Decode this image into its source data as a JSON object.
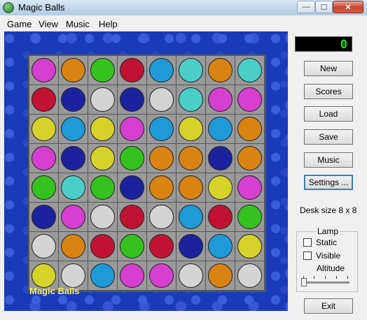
{
  "window": {
    "title": "Magic Balls",
    "minimize": "—",
    "maximize": "☐",
    "close": "✕"
  },
  "menu": [
    "Game",
    "View",
    "Music",
    "Help"
  ],
  "score": "0",
  "buttons": {
    "new": "New",
    "scores": "Scores",
    "load": "Load",
    "save": "Save",
    "music": "Music",
    "settings": "Settings ...",
    "exit": "Exit"
  },
  "desk_size": "Desk size 8 x 8",
  "lamp": {
    "legend": "Lamp",
    "static": "Static",
    "visible": "Visible",
    "altitude": "Altitude"
  },
  "board_label": "Magic Balls",
  "colors": {
    "M": "#d63fcf",
    "O": "#d98313",
    "G": "#35c21f",
    "R": "#c21233",
    "B": "#1e9ad8",
    "T": "#4ccec8",
    "N": "#1c229e",
    "W": "#d4d4d4",
    "Y": "#d6d22a"
  },
  "board": [
    [
      "M",
      "O",
      "G",
      "R",
      "B",
      "T",
      "O",
      "T"
    ],
    [
      "R",
      "N",
      "W",
      "N",
      "W",
      "T",
      "M",
      "M"
    ],
    [
      "Y",
      "B",
      "Y",
      "M",
      "B",
      "Y",
      "B",
      "O"
    ],
    [
      "M",
      "N",
      "Y",
      "G",
      "O",
      "O",
      "N",
      "O"
    ],
    [
      "G",
      "T",
      "G",
      "N",
      "O",
      "O",
      "Y",
      "M"
    ],
    [
      "N",
      "M",
      "W",
      "R",
      "W",
      "B",
      "R",
      "G"
    ],
    [
      "W",
      "O",
      "R",
      "G",
      "R",
      "N",
      "B",
      "Y"
    ],
    [
      "Y",
      "W",
      "B",
      "M",
      "M",
      "W",
      "O",
      "W"
    ]
  ]
}
